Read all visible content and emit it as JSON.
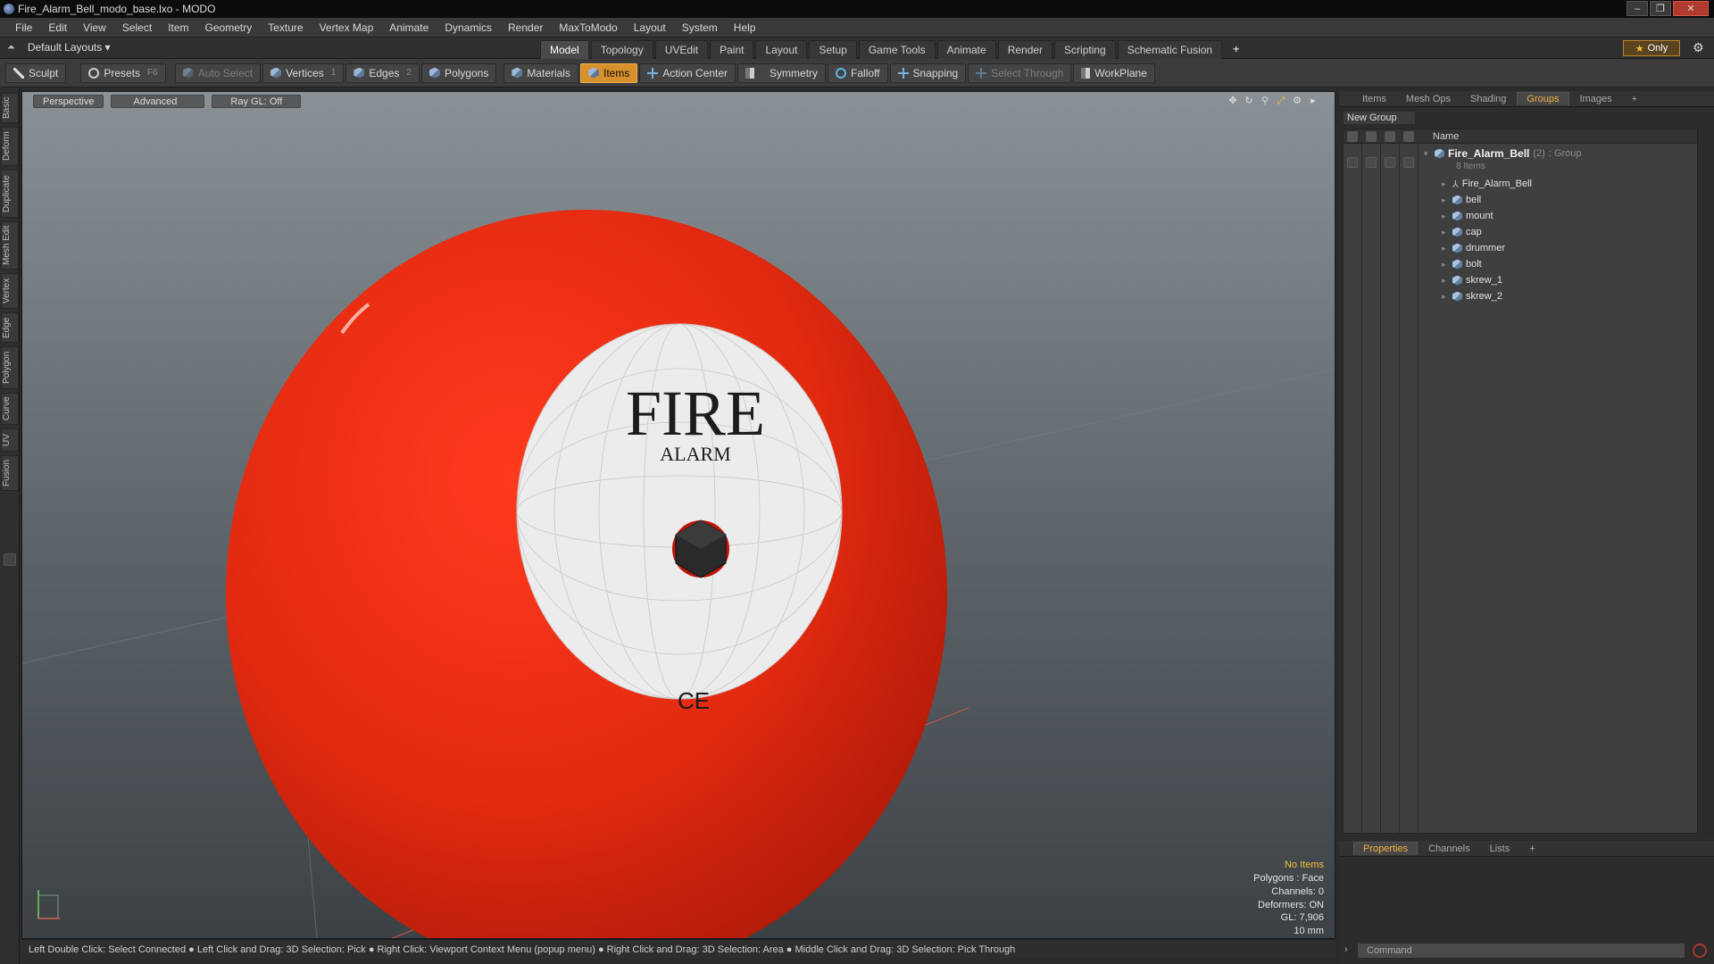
{
  "window": {
    "title": "Fire_Alarm_Bell_modo_base.lxo - MODO",
    "buttons": [
      "–",
      "❐",
      "✕"
    ]
  },
  "menu": [
    "File",
    "Edit",
    "View",
    "Select",
    "Item",
    "Geometry",
    "Texture",
    "Vertex Map",
    "Animate",
    "Dynamics",
    "Render",
    "MaxToModo",
    "Layout",
    "System",
    "Help"
  ],
  "layoutbar": {
    "layouts_label": "Default Layouts ▾",
    "tabs": [
      "Model",
      "Topology",
      "UVEdit",
      "Paint",
      "Layout",
      "Setup",
      "Game Tools",
      "Animate",
      "Render",
      "Scripting",
      "Schematic Fusion"
    ],
    "active_tab": "Model",
    "add": "+",
    "only": "Only",
    "gear": "⚙"
  },
  "toolbar": {
    "sculpt": "Sculpt",
    "presets": "Presets",
    "presets_key": "F6",
    "auto_select": "Auto Select",
    "vertices": "Vertices",
    "vertices_count": "1",
    "edges": "Edges",
    "edges_count": "2",
    "polygons": "Polygons",
    "materials": "Materials",
    "items": "Items",
    "action_center": "Action Center",
    "symmetry": "Symmetry",
    "falloff": "Falloff",
    "snapping": "Snapping",
    "select_through": "Select Through",
    "workplane": "WorkPlane"
  },
  "left_tabs": [
    "Basic",
    "Deform",
    "Duplicate",
    "Mesh Edit",
    "Vertex",
    "Edge",
    "Polygon",
    "Curve",
    "UV",
    "Fusion"
  ],
  "viewport": {
    "perspective": "Perspective",
    "advanced": "Advanced",
    "raygl": "Ray GL: Off",
    "label_fire": "FIRE",
    "label_alarm": "ALARM",
    "label_ce": "CE",
    "stats": {
      "selection": "No Items",
      "polygons": "Polygons : Face",
      "channels": "Channels: 0",
      "deformers": "Deformers: ON",
      "gl": "GL: 7,906",
      "scale": "10 mm"
    },
    "colors": {
      "bell": "#e82a12",
      "face": "#ececec",
      "bolt": "#2a2a2a"
    }
  },
  "statusbar": "Left Double Click: Select Connected ● Left Click and Drag: 3D Selection: Pick ● Right Click: Viewport Context Menu (popup menu) ● Right Click and Drag: 3D Selection: Area ● Middle Click and Drag: 3D Selection: Pick Through",
  "panel": {
    "tabs": [
      "Items",
      "Mesh Ops",
      "Shading",
      "Groups",
      "Images"
    ],
    "active_tab": "Groups",
    "new_group": "New Group",
    "column_name": "Name",
    "group": {
      "name": "Fire_Alarm_Bell",
      "count": "(2)",
      "type": ": Group",
      "sub": "8 Items"
    },
    "items": [
      "Fire_Alarm_Bell",
      "bell",
      "mount",
      "cap",
      "drummer",
      "bolt",
      "skrew_1",
      "skrew_2"
    ],
    "bottom_tabs": [
      "Properties",
      "Channels",
      "Lists"
    ],
    "bottom_active": "Properties",
    "command_placeholder": "Command"
  }
}
